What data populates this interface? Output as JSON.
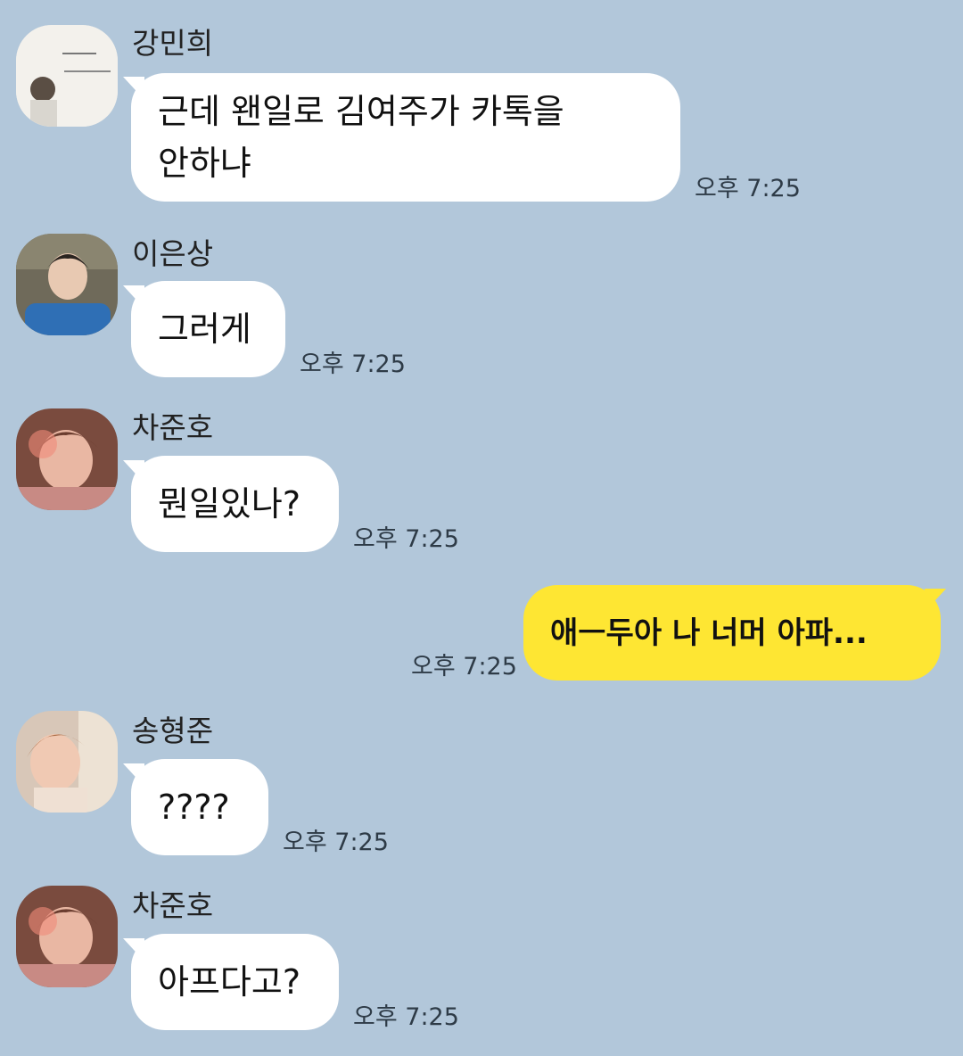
{
  "chat": {
    "messages": [
      {
        "sender": "강민희",
        "text": "근데 왠일로 김여주가 카톡을\n안하냐",
        "time": "오후 7:25",
        "avatar": "avatar-photo-icon"
      },
      {
        "sender": "이은상",
        "text": "그러게",
        "time": "오후 7:25",
        "avatar": "avatar-photo-icon"
      },
      {
        "sender": "차준호",
        "text": "뭔일있나?",
        "time": "오후 7:25",
        "avatar": "avatar-photo-icon"
      },
      {
        "sender": "",
        "text": "애ㅡ두아 나 너머 아파...",
        "time": "오후 7:25",
        "mine": true
      },
      {
        "sender": "송형준",
        "text": "????",
        "time": "오후 7:25",
        "avatar": "avatar-photo-icon"
      },
      {
        "sender": "차준호",
        "text": "아프다고?",
        "time": "오후 7:25",
        "avatar": "avatar-photo-icon"
      }
    ]
  },
  "colors": {
    "background": "#b2c7da",
    "bubble_other": "#ffffff",
    "bubble_mine": "#fee633"
  }
}
